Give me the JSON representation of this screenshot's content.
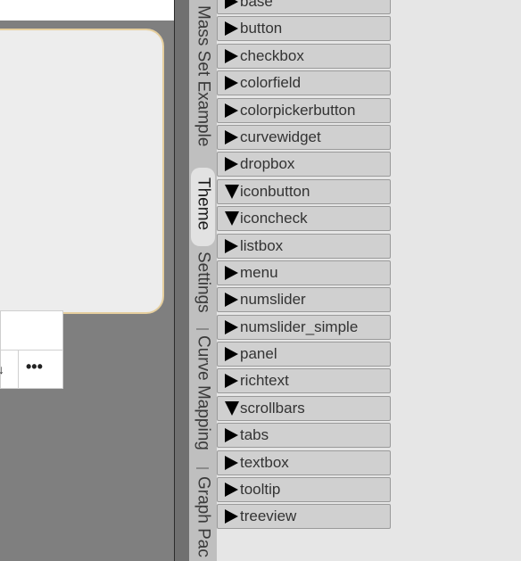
{
  "canvas": {
    "more_label": "•••",
    "fragment_glyph": "↓"
  },
  "tabs": [
    {
      "label": "Mass Set Example",
      "active": false
    },
    {
      "label": "Theme",
      "active": true
    },
    {
      "label": "Settings",
      "active": false
    },
    {
      "label": "Curve Mapping",
      "active": false
    },
    {
      "label": "Graph Pac",
      "active": false
    }
  ],
  "theme_items": [
    {
      "label": "base",
      "expanded": false
    },
    {
      "label": "button",
      "expanded": false
    },
    {
      "label": "checkbox",
      "expanded": false
    },
    {
      "label": "colorfield",
      "expanded": false
    },
    {
      "label": "colorpickerbutton",
      "expanded": false
    },
    {
      "label": "curvewidget",
      "expanded": false
    },
    {
      "label": "dropbox",
      "expanded": false
    },
    {
      "label": "iconbutton",
      "expanded": true
    },
    {
      "label": "iconcheck",
      "expanded": true
    },
    {
      "label": "listbox",
      "expanded": false
    },
    {
      "label": "menu",
      "expanded": false
    },
    {
      "label": "numslider",
      "expanded": false
    },
    {
      "label": "numslider_simple",
      "expanded": false
    },
    {
      "label": "panel",
      "expanded": false
    },
    {
      "label": "richtext",
      "expanded": false
    },
    {
      "label": "scrollbars",
      "expanded": true
    },
    {
      "label": "tabs",
      "expanded": false
    },
    {
      "label": "textbox",
      "expanded": false
    },
    {
      "label": "tooltip",
      "expanded": false
    },
    {
      "label": "treeview",
      "expanded": false
    }
  ],
  "colors": {
    "canvas_gray": "#7f7f7f",
    "panel_border": "#e6cf9e",
    "item_bg": "#d0d0d0",
    "strip_bg": "#bfbfbf",
    "active_tab_bg": "#e2e2e2"
  }
}
